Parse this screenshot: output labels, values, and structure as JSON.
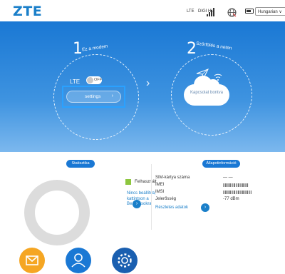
{
  "header": {
    "logo": "ZTE",
    "network_type": "LTE",
    "operator": "DIGI HU",
    "language": "Hungarian ∨"
  },
  "hero": {
    "step1_num": "1",
    "step1_label": "Ez a modem",
    "lte_label": "LTE",
    "toggle_state": "OFF",
    "settings_label": "settings",
    "settings_chevron": "›",
    "arrow": "›",
    "step2_num": "2",
    "step2_label": "Szörfölés a neten",
    "connection_status": "Kapcsolat bontva"
  },
  "stats": {
    "badge": "Statisztika",
    "legend_label": "Felhasznált",
    "link_text": "Nincs beállítva; kattintson a Beállításokra",
    "link_arrow": "›"
  },
  "status_info": {
    "badge": "Állapotinformáció",
    "rows": [
      {
        "label": "SIM-kártya száma",
        "value": "— —"
      },
      {
        "label": "IMEI",
        "value": ""
      },
      {
        "label": "IMSI",
        "value": ""
      },
      {
        "label": "Jelerősség",
        "value": "-77 dBm"
      }
    ],
    "details_link": "Részletes adatok",
    "details_arrow": "›"
  },
  "bottom_icons": [
    "envelope-icon",
    "user-icon",
    "gear-icon"
  ],
  "colors": {
    "brand": "#1a7fc9",
    "hero_top": "#1a78d4",
    "highlight": "#2aa1ff",
    "legend_used": "#8dc63f",
    "mail": "#f5a623",
    "user": "#1a78d4",
    "settings": "#1a5fb0"
  }
}
